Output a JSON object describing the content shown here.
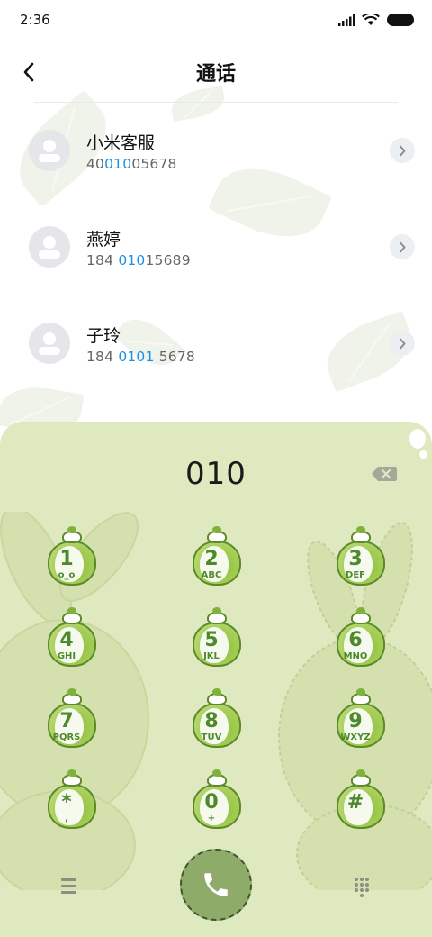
{
  "status_bar": {
    "time": "2:36",
    "icons": [
      "signal-icon",
      "wifi-icon",
      "battery-icon"
    ]
  },
  "header": {
    "title": "通话",
    "back_icon": "chevron-left-icon"
  },
  "contacts": [
    {
      "name": "小米客服",
      "number_parts": [
        "40",
        "010",
        "05678"
      ]
    },
    {
      "name": "燕婷",
      "number_parts": [
        "184 ",
        "010",
        "15689"
      ]
    },
    {
      "name": "子玲",
      "number_parts": [
        "184 ",
        "0101",
        " 5678"
      ]
    }
  ],
  "dialer": {
    "input": "010",
    "delete_icon": "backspace-icon",
    "keys": [
      {
        "digit": "1",
        "letters": "o_o"
      },
      {
        "digit": "2",
        "letters": "ABC"
      },
      {
        "digit": "3",
        "letters": "DEF"
      },
      {
        "digit": "4",
        "letters": "GHI"
      },
      {
        "digit": "5",
        "letters": "JKL"
      },
      {
        "digit": "6",
        "letters": "MNO"
      },
      {
        "digit": "7",
        "letters": "PQRS"
      },
      {
        "digit": "8",
        "letters": "TUV"
      },
      {
        "digit": "9",
        "letters": "WXYZ"
      },
      {
        "digit": "*",
        "letters": ","
      },
      {
        "digit": "0",
        "letters": "+"
      },
      {
        "digit": "#",
        "letters": ""
      }
    ],
    "bottom": {
      "menu_icon": "menu-icon",
      "call_icon": "phone-icon",
      "dialpad_icon": "dialpad-icon"
    }
  },
  "colors": {
    "highlight": "#1890e8",
    "panel_bg": "#dfe9bf",
    "key_green": "#4e8a2c",
    "call_button": "#8eab6a"
  }
}
